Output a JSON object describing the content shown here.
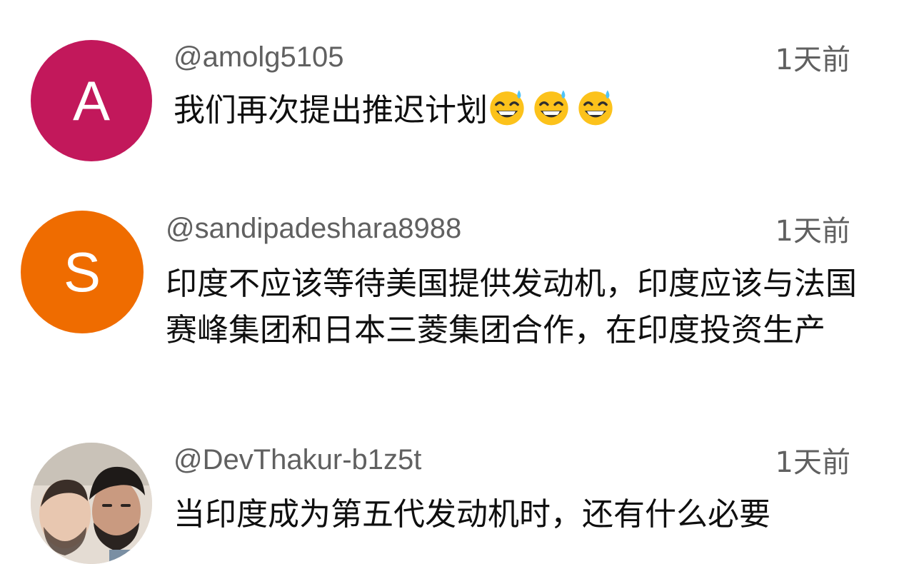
{
  "comments": [
    {
      "avatar_letter": "A",
      "avatar_color": "#c2185b",
      "handle": "@amolg5105",
      "time": "1天前",
      "text": "我们再次提出推迟计划",
      "emojis": [
        "grinning-sweat-emoji",
        "grinning-sweat-emoji",
        "grinning-sweat-emoji"
      ]
    },
    {
      "avatar_letter": "S",
      "avatar_color": "#ef6c00",
      "handle": "@sandipadeshara8988",
      "time": "1天前",
      "text": "印度不应该等待美国提供发动机，印度应该与法国赛峰集团和日本三菱集团合作，在印度投资生产"
    },
    {
      "avatar_icon": "user-photo",
      "handle": "@DevThakur-b1z5t",
      "time": "1天前",
      "text": "当印度成为第五代发动机时，还有什么必要"
    }
  ]
}
